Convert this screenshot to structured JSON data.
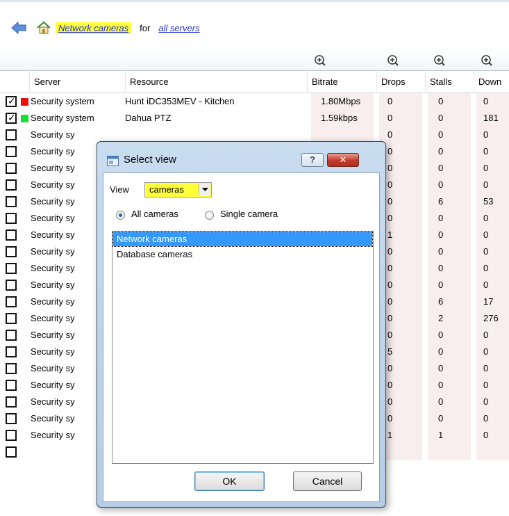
{
  "breadcrumb": {
    "back_icon": "back-arrow-icon",
    "home_icon": "home-icon",
    "view_link": "Network cameras",
    "separator": "for",
    "scope_link": "all servers"
  },
  "table": {
    "zoom_icon": "zoom-in-icon",
    "columns": [
      "Server",
      "Resource",
      "Bitrate",
      "Drops",
      "Stalls",
      "Down"
    ],
    "rows": [
      {
        "checked": true,
        "status": "#e81010",
        "server": "Security system",
        "resource": "Hunt iDC353MEV - Kitchen",
        "bitrate": "1.80Mbps",
        "drops": "0",
        "stalls": "0",
        "down": "0"
      },
      {
        "checked": true,
        "status": "#18e030",
        "server": "Security system",
        "resource": "Dahua PTZ",
        "bitrate": "1.59kbps",
        "drops": "0",
        "stalls": "0",
        "down": "181"
      },
      {
        "checked": false,
        "status": "",
        "server": "Security sy",
        "resource": "",
        "bitrate": "",
        "drops": "0",
        "stalls": "0",
        "down": "0"
      },
      {
        "checked": false,
        "status": "",
        "server": "Security sy",
        "resource": "",
        "bitrate": "",
        "drops": "0",
        "stalls": "0",
        "down": "0"
      },
      {
        "checked": false,
        "status": "",
        "server": "Security sy",
        "resource": "",
        "bitrate": "",
        "drops": "0",
        "stalls": "0",
        "down": "0"
      },
      {
        "checked": false,
        "status": "",
        "server": "Security sy",
        "resource": "",
        "bitrate": "",
        "drops": "0",
        "stalls": "0",
        "down": "0"
      },
      {
        "checked": false,
        "status": "",
        "server": "Security sy",
        "resource": "",
        "bitrate": "",
        "drops": "0",
        "stalls": "6",
        "down": "53"
      },
      {
        "checked": false,
        "status": "",
        "server": "Security sy",
        "resource": "",
        "bitrate": "",
        "drops": "0",
        "stalls": "0",
        "down": "0"
      },
      {
        "checked": false,
        "status": "",
        "server": "Security sy",
        "resource": "",
        "bitrate": "",
        "drops": "1",
        "stalls": "0",
        "down": "0"
      },
      {
        "checked": false,
        "status": "",
        "server": "Security sy",
        "resource": "",
        "bitrate": "",
        "drops": "0",
        "stalls": "0",
        "down": "0"
      },
      {
        "checked": false,
        "status": "",
        "server": "Security sy",
        "resource": "",
        "bitrate": "",
        "drops": "0",
        "stalls": "0",
        "down": "0"
      },
      {
        "checked": false,
        "status": "",
        "server": "Security sy",
        "resource": "",
        "bitrate": "",
        "drops": "0",
        "stalls": "0",
        "down": "0"
      },
      {
        "checked": false,
        "status": "",
        "server": "Security sy",
        "resource": "",
        "bitrate": "",
        "drops": "0",
        "stalls": "6",
        "down": "17"
      },
      {
        "checked": false,
        "status": "",
        "server": "Security sy",
        "resource": "",
        "bitrate": "",
        "drops": "0",
        "stalls": "2",
        "down": "276"
      },
      {
        "checked": false,
        "status": "",
        "server": "Security sy",
        "resource": "",
        "bitrate": "",
        "drops": "0",
        "stalls": "0",
        "down": "0"
      },
      {
        "checked": false,
        "status": "",
        "server": "Security sy",
        "resource": "",
        "bitrate": "",
        "drops": "5",
        "stalls": "0",
        "down": "0"
      },
      {
        "checked": false,
        "status": "",
        "server": "Security sy",
        "resource": "",
        "bitrate": "",
        "drops": "0",
        "stalls": "0",
        "down": "0"
      },
      {
        "checked": false,
        "status": "",
        "server": "Security sy",
        "resource": "",
        "bitrate": "",
        "drops": "0",
        "stalls": "0",
        "down": "0"
      },
      {
        "checked": false,
        "status": "",
        "server": "Security sy",
        "resource": "",
        "bitrate": "",
        "drops": "0",
        "stalls": "0",
        "down": "0"
      },
      {
        "checked": false,
        "status": "",
        "server": "Security sy",
        "resource": "",
        "bitrate": "",
        "drops": "0",
        "stalls": "0",
        "down": "0"
      },
      {
        "checked": false,
        "status": "",
        "server": "Security sy",
        "resource": "",
        "bitrate": "",
        "drops": "1",
        "stalls": "1",
        "down": "0"
      },
      {
        "checked": false,
        "status": "",
        "server": "",
        "resource": "",
        "bitrate": "",
        "drops": "",
        "stalls": "",
        "down": ""
      }
    ]
  },
  "dialog": {
    "title": "Select view",
    "title_icon": "window-icon",
    "help_label": "?",
    "close_icon": "close-icon",
    "view_label": "View",
    "view_value": "cameras",
    "radio_all": "All cameras",
    "radio_single": "Single camera",
    "list_items": [
      "Network cameras",
      "Database cameras"
    ],
    "selected_index": 0,
    "ok_label": "OK",
    "cancel_label": "Cancel"
  },
  "colors": {
    "highlight": "#ffff3a",
    "link": "#1f2fd6",
    "selection": "#3399ff",
    "stat_column_bg": "#f8eeee"
  }
}
